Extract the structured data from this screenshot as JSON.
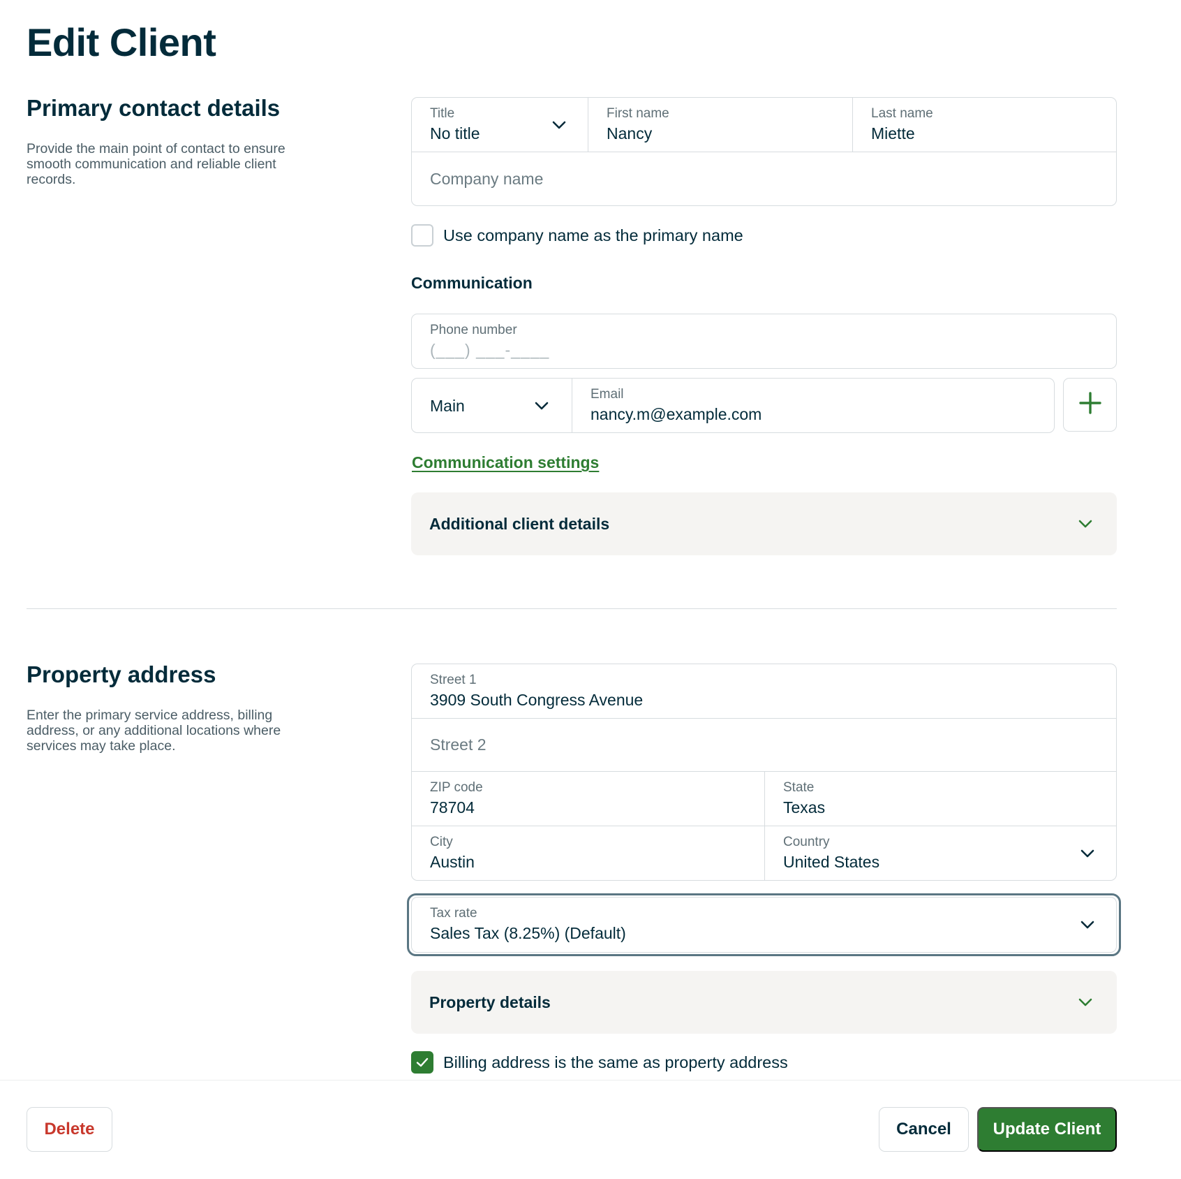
{
  "page": {
    "title": "Edit Client"
  },
  "primary_contact": {
    "heading": "Primary contact details",
    "description": "Provide the main point of contact to ensure smooth communication and reliable client records.",
    "title_label": "Title",
    "title_value": "No title",
    "first_name_label": "First name",
    "first_name_value": "Nancy",
    "last_name_label": "Last name",
    "last_name_value": "Miette",
    "company_placeholder": "Company name",
    "use_company_label": "Use company name as the primary name",
    "use_company_checked": false
  },
  "communication": {
    "heading": "Communication",
    "phone_label": "Phone number",
    "phone_mask": "(___) ___-____",
    "email_type": "Main",
    "email_label": "Email",
    "email_value": "nancy.m@example.com",
    "settings_link": "Communication settings",
    "additional_details": "Additional client details"
  },
  "property": {
    "heading": "Property address",
    "description": "Enter the primary service address, billing address, or any additional locations where services may take place.",
    "street1_label": "Street 1",
    "street1_value": "3909 South Congress Avenue",
    "street2_placeholder": "Street 2",
    "zip_label": "ZIP code",
    "zip_value": "78704",
    "state_label": "State",
    "state_value": "Texas",
    "city_label": "City",
    "city_value": "Austin",
    "country_label": "Country",
    "country_value": "United States",
    "tax_label": "Tax rate",
    "tax_value": "Sales Tax (8.25%) (Default)",
    "property_details": "Property details",
    "billing_same_label": "Billing address is the same as property address",
    "billing_same_checked": true
  },
  "footer": {
    "delete_label": "Delete",
    "cancel_label": "Cancel",
    "update_label": "Update Client"
  },
  "colors": {
    "brand_green": "#2e7d32",
    "danger_red": "#c8382c",
    "text_dark": "#032b3a"
  }
}
